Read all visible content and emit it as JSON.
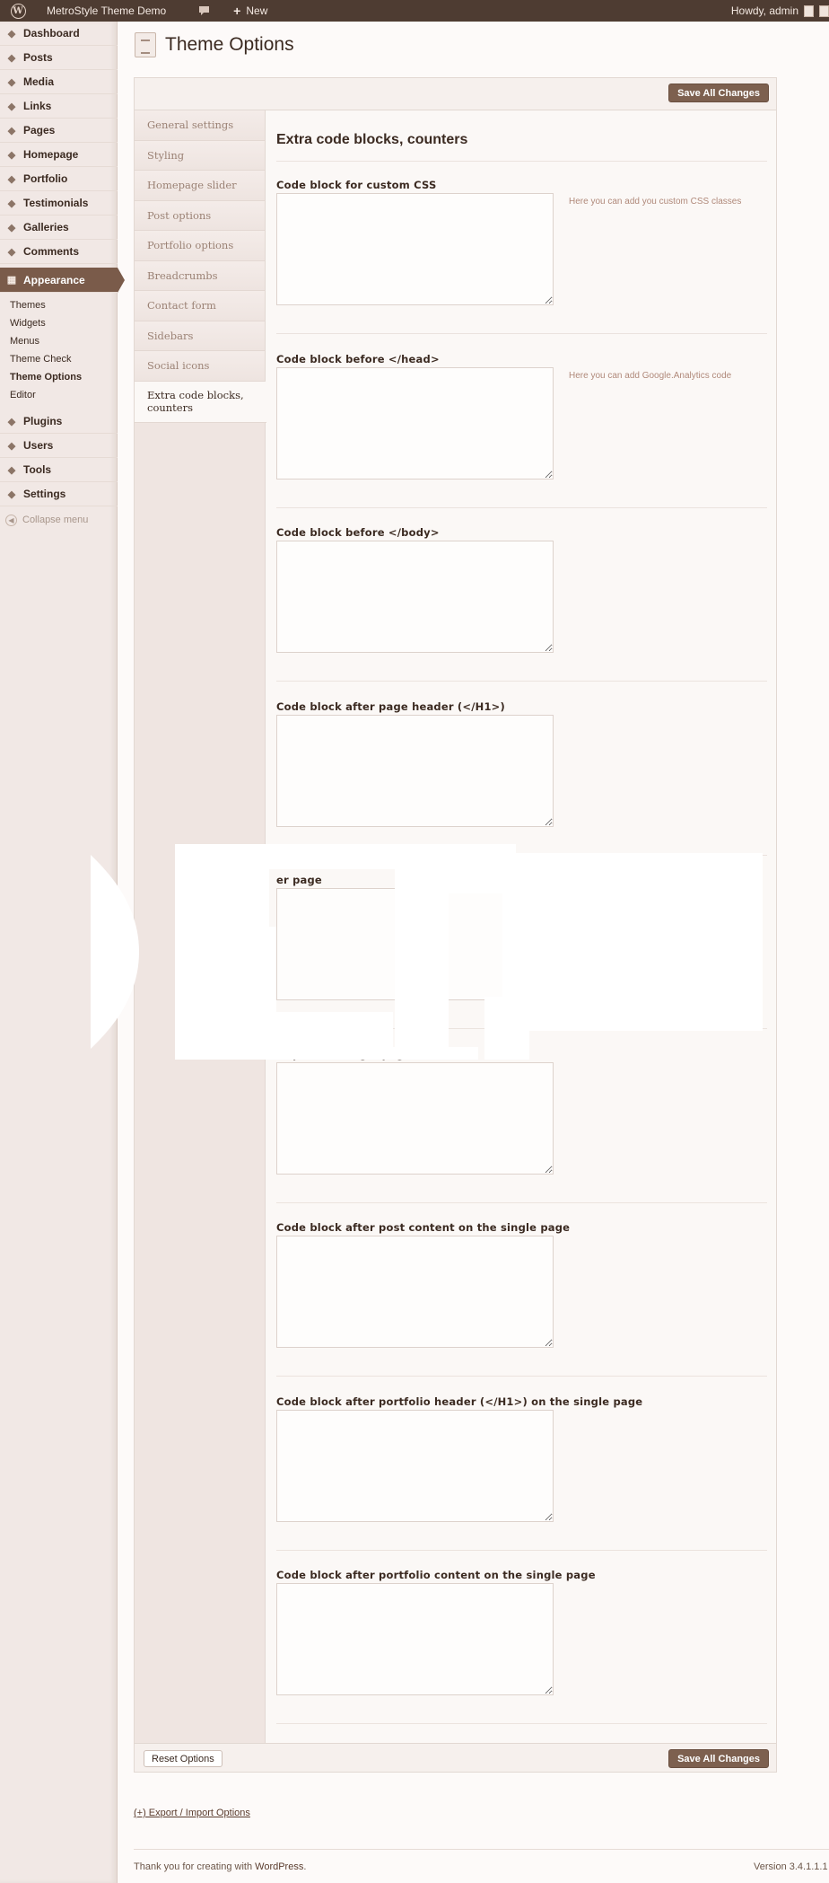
{
  "adminbar": {
    "site_name": "MetroStyle Theme Demo",
    "new_label": "New",
    "howdy": "Howdy, admin"
  },
  "menu": {
    "items_before": [
      {
        "label": "Dashboard",
        "icon": "dashboard-icon"
      },
      {
        "label": "Posts",
        "icon": "pin-icon"
      },
      {
        "label": "Media",
        "icon": "media-icon"
      },
      {
        "label": "Links",
        "icon": "link-icon"
      },
      {
        "label": "Pages",
        "icon": "pages-icon"
      },
      {
        "label": "Homepage",
        "icon": "pin-icon"
      },
      {
        "label": "Portfolio",
        "icon": "pin-icon"
      },
      {
        "label": "Testimonials",
        "icon": "pin-icon"
      },
      {
        "label": "Galleries",
        "icon": "gallery-icon"
      },
      {
        "label": "Comments",
        "icon": "comment-icon"
      }
    ],
    "current": {
      "label": "Appearance",
      "icon": "appearance-icon"
    },
    "submenu": [
      "Themes",
      "Widgets",
      "Menus",
      "Theme Check",
      "Theme Options",
      "Editor"
    ],
    "submenu_current": "Theme Options",
    "items_after": [
      {
        "label": "Plugins",
        "icon": "plugin-icon"
      },
      {
        "label": "Users",
        "icon": "users-icon"
      },
      {
        "label": "Tools",
        "icon": "tools-icon"
      },
      {
        "label": "Settings",
        "icon": "settings-icon"
      }
    ],
    "collapse_label": "Collapse menu"
  },
  "page": {
    "title": "Theme Options",
    "save_label": "Save All Changes",
    "reset_label": "Reset Options"
  },
  "tabs": [
    "General settings",
    "Styling",
    "Homepage slider",
    "Post options",
    "Portfolio options",
    "Breadcrumbs",
    "Contact form",
    "Sidebars",
    "Social icons",
    "Extra code blocks, counters"
  ],
  "active_tab": "Extra code blocks, counters",
  "section": {
    "title": "Extra code blocks, counters",
    "fields": [
      {
        "label": "Code block for custom CSS",
        "help": "Here you can add you custom CSS classes",
        "value": ""
      },
      {
        "label": "Code block before </head>",
        "help": "Here you can add Google.Analytics code",
        "value": ""
      },
      {
        "label": "Code block before </body>",
        "help": "",
        "value": ""
      },
      {
        "label": "Code block after page header (</H1>)",
        "help": "",
        "value": ""
      },
      {
        "label": "er page",
        "help": "",
        "value": ""
      },
      {
        "label": "er post :/H1> gle pag",
        "help": "",
        "value": ""
      },
      {
        "label": "Code block after post content on the single page",
        "help": "",
        "value": ""
      },
      {
        "label": "Code block after portfolio header (</H1>) on the single page",
        "help": "",
        "value": ""
      },
      {
        "label": "Code block after portfolio content on the single page",
        "help": "",
        "value": ""
      }
    ]
  },
  "export_link": "(+) Export / Import Options",
  "footer": {
    "thanks_prefix": "Thank you for creating with",
    "wordpress": "WordPress",
    "thanks_suffix": ".",
    "version": "Version 3.4.1.1.1"
  },
  "colors": {
    "adminbar": "#4e3c32",
    "accent": "#7a5b4a",
    "button": "#7d604f",
    "menu_bg": "#f1e8e5"
  }
}
